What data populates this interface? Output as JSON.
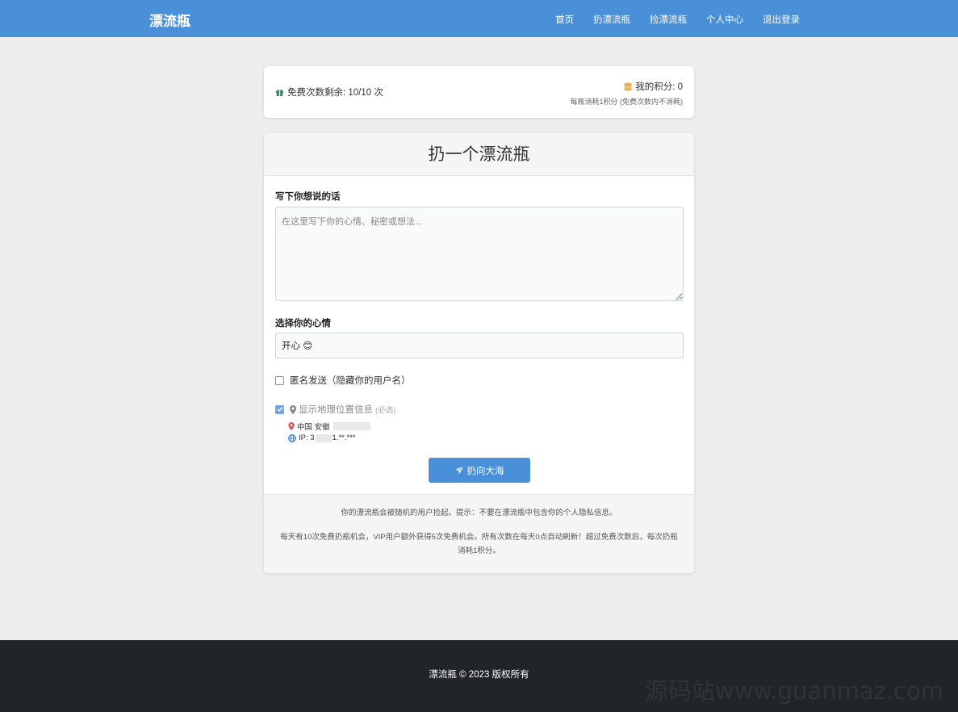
{
  "nav": {
    "brand": "漂流瓶",
    "items": [
      {
        "label": "首页"
      },
      {
        "label": "扔漂流瓶"
      },
      {
        "label": "捡漂流瓶"
      },
      {
        "label": "个人中心"
      },
      {
        "label": "退出登录"
      }
    ]
  },
  "stats": {
    "free_text": "免费次数剩余: 10/10 次",
    "points_text": "我的积分: 0",
    "points_hint": "每瓶消耗1积分 (免费次数内不消耗)"
  },
  "form": {
    "title": "扔一个漂流瓶",
    "message_label": "写下你想说的话",
    "message_placeholder": "在这里写下你的心情、秘密或想法...",
    "message_value": "",
    "mood_label": "选择你的心情",
    "mood_value": "开心 😊",
    "anonymous_label": "匿名发送（隐藏你的用户名）",
    "anonymous_checked": false,
    "location_label": "显示地理位置信息",
    "location_required": "(必选)",
    "location_checked": true,
    "location_text": "中国 安徽",
    "ip_prefix": "IP: 3",
    "ip_suffix": "1.**.***",
    "submit_label": "扔向大海"
  },
  "notes": {
    "line1": "你的漂流瓶会被随机的用户捡起。提示：不要在漂流瓶中包含你的个人隐私信息。",
    "line2": "每天有10次免费扔瓶机会，VIP用户额外获得5次免费机会。所有次数在每天0点自动刷新！超过免费次数后，每次扔瓶消耗1积分。"
  },
  "footer": {
    "copyright": "漂流瓶 © 2023 版权所有",
    "watermark": "源码站www.guanmaz.com"
  },
  "colors": {
    "primary": "#4a90d9",
    "footer_bg": "#212529",
    "gift_icon": "#2e8b57",
    "coins_icon": "#f0ad4e",
    "pin_icon": "#d9534f",
    "globe_icon": "#2a6fc9"
  }
}
